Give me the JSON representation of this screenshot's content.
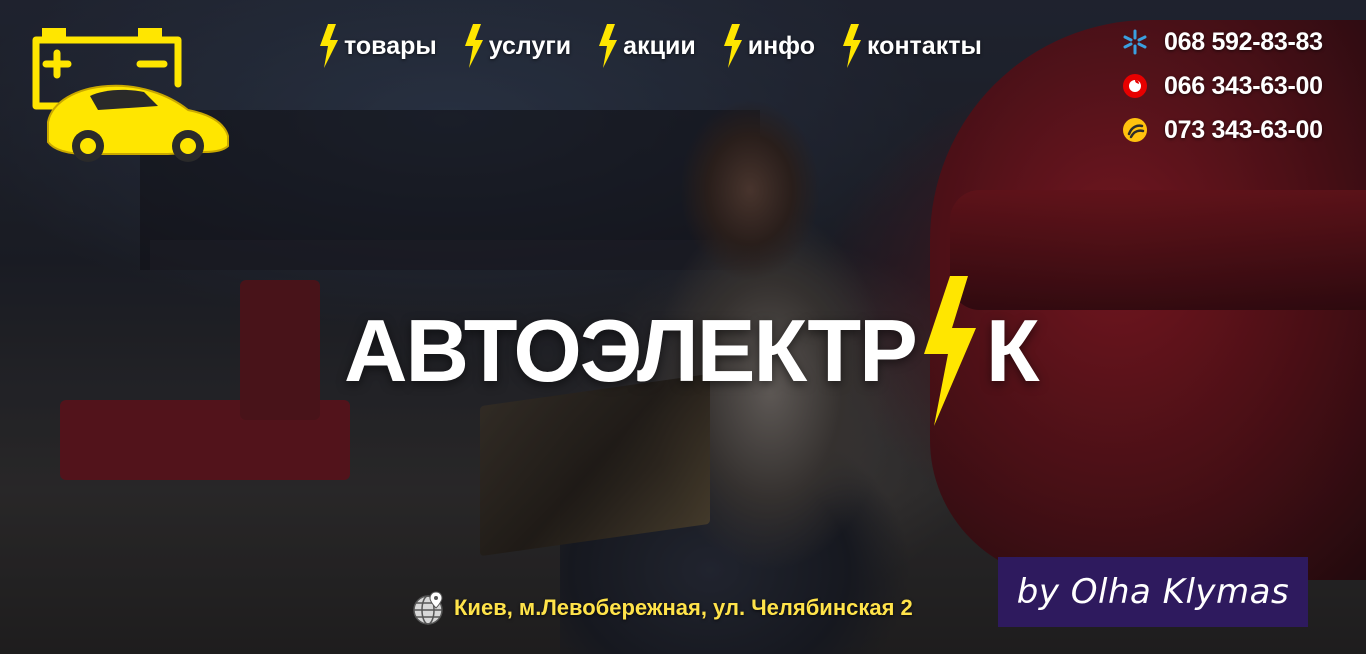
{
  "brand": {
    "logo_icon": "battery-car-icon",
    "accent_color": "#ffe600"
  },
  "nav": {
    "items": [
      {
        "label": "товары",
        "icon": "lightning-icon"
      },
      {
        "label": "услуги",
        "icon": "lightning-icon"
      },
      {
        "label": "акции",
        "icon": "lightning-icon"
      },
      {
        "label": "инфо",
        "icon": "lightning-icon"
      },
      {
        "label": "контакты",
        "icon": "lightning-icon"
      }
    ]
  },
  "phones": [
    {
      "number": "068 592-83-83",
      "operator_icon": "kyivstar-icon",
      "color": "#3aa0e0"
    },
    {
      "number": "066 343-63-00",
      "operator_icon": "vodafone-icon",
      "color": "#e60000"
    },
    {
      "number": "073 343-63-00",
      "operator_icon": "lifecell-icon",
      "color": "#ffc20e"
    }
  ],
  "hero": {
    "title_part1": "АВТОЭЛЕКТР",
    "title_part2": "К",
    "title_bolt_icon": "lightning-icon"
  },
  "address": {
    "text": "Киев, м.Левобережная, ул. Челябинская 2",
    "icon": "globe-pin-icon"
  },
  "credit": {
    "text": "by Olha Klymas",
    "bg_color": "#2e1a5e"
  }
}
